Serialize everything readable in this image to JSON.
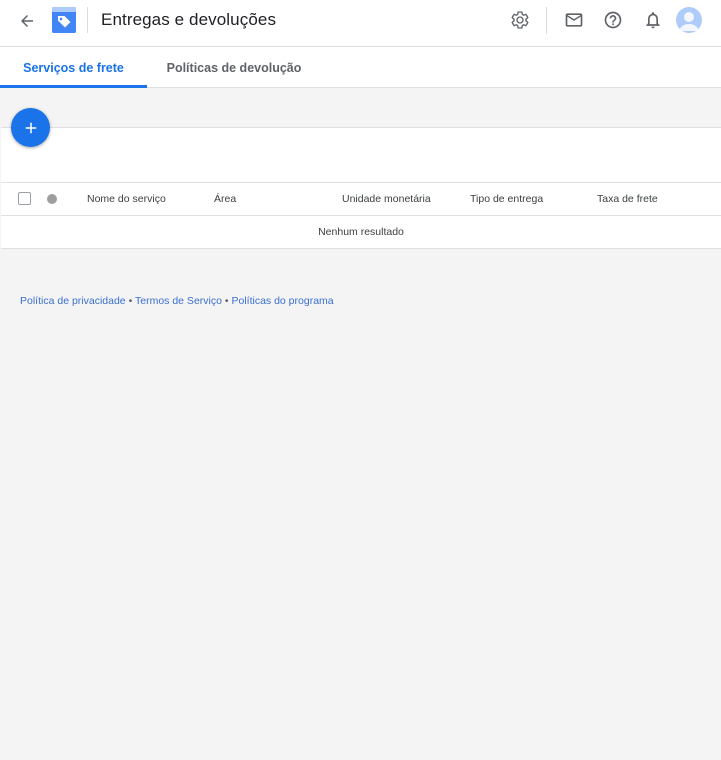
{
  "header": {
    "title": "Entregas e devoluções",
    "icons": [
      "arrow-back-icon",
      "merchant-logo-icon",
      "gear-icon",
      "mail-icon",
      "help-icon",
      "bell-icon",
      "avatar"
    ]
  },
  "tabs": [
    {
      "label": "Serviços de frete",
      "active": true
    },
    {
      "label": "Políticas de devolução",
      "active": false
    }
  ],
  "table": {
    "columns": [
      "Nome do serviço",
      "Área",
      "Unidade monetária",
      "Tipo de entrega",
      "Taxa de frete"
    ],
    "empty_message": "Nenhum resultado"
  },
  "footer": {
    "links": [
      "Política de privacidade",
      "Termos de Serviço",
      "Políticas do programa"
    ],
    "separator": "•"
  },
  "colors": {
    "accent": "#1a73e8",
    "background": "#f4f4f4",
    "surface": "#ffffff",
    "divider": "#e0e0e0"
  }
}
